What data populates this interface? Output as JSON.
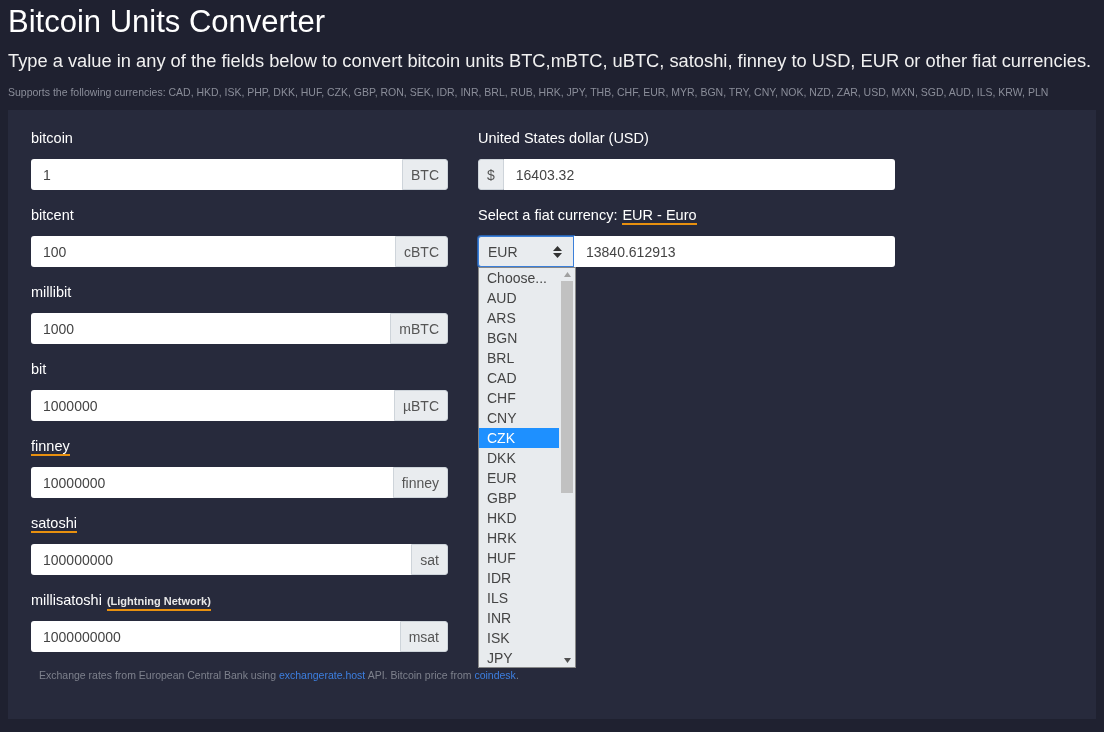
{
  "title": "Bitcoin Units Converter",
  "subtitle": "Type a value in any of the fields below to convert bitcoin units BTC,mBTC, uBTC, satoshi, finney to USD, EUR or other fiat currencies.",
  "supported": "Supports the following currencies: CAD, HKD, ISK, PHP, DKK, HUF, CZK, GBP, RON, SEK, IDR, INR, BRL, RUB, HRK, JPY, THB, CHF, EUR, MYR, BGN, TRY, CNY, NOK, NZD, ZAR, USD, MXN, SGD, AUD, ILS, KRW, PLN",
  "units": [
    {
      "label": "bitcoin",
      "underlined": false,
      "value": "1",
      "unit": "BTC"
    },
    {
      "label": "bitcent",
      "underlined": false,
      "value": "100",
      "unit": "cBTC"
    },
    {
      "label": "millibit",
      "underlined": false,
      "value": "1000",
      "unit": "mBTC"
    },
    {
      "label": "bit",
      "underlined": false,
      "value": "1000000",
      "unit": "µBTC"
    },
    {
      "label": "finney",
      "underlined": true,
      "value": "10000000",
      "unit": "finney"
    },
    {
      "label": "satoshi",
      "underlined": true,
      "value": "100000000",
      "unit": "sat"
    },
    {
      "label": "millisatoshi",
      "underlined": false,
      "note": "(Lightning Network)",
      "value": "1000000000",
      "unit": "msat"
    }
  ],
  "usd": {
    "label": "United States dollar (USD)",
    "symbol": "$",
    "value": "16403.32"
  },
  "fiat": {
    "label": "Select a fiat currency:",
    "currency_name": "EUR - Euro",
    "selected_code": "EUR",
    "value": "13840.612913",
    "expanded": true,
    "options": [
      {
        "label": "Choose...",
        "selected": false
      },
      {
        "label": "AUD",
        "selected": false
      },
      {
        "label": "ARS",
        "selected": false
      },
      {
        "label": "BGN",
        "selected": false
      },
      {
        "label": "BRL",
        "selected": false
      },
      {
        "label": "CAD",
        "selected": false
      },
      {
        "label": "CHF",
        "selected": false
      },
      {
        "label": "CNY",
        "selected": false
      },
      {
        "label": "CZK",
        "selected": true
      },
      {
        "label": "DKK",
        "selected": false
      },
      {
        "label": "EUR",
        "selected": false
      },
      {
        "label": "GBP",
        "selected": false
      },
      {
        "label": "HKD",
        "selected": false
      },
      {
        "label": "HRK",
        "selected": false
      },
      {
        "label": "HUF",
        "selected": false
      },
      {
        "label": "IDR",
        "selected": false
      },
      {
        "label": "ILS",
        "selected": false
      },
      {
        "label": "INR",
        "selected": false
      },
      {
        "label": "ISK",
        "selected": false
      },
      {
        "label": "JPY",
        "selected": false
      }
    ]
  },
  "footer": [
    {
      "kind": "text",
      "text": "Exchange rates from European Central Bank using "
    },
    {
      "kind": "link",
      "text": "exchangerate.host"
    },
    {
      "kind": "text",
      "text": " API. Bitcoin price from "
    },
    {
      "kind": "link",
      "text": "coindesk"
    },
    {
      "kind": "text",
      "text": "."
    }
  ]
}
